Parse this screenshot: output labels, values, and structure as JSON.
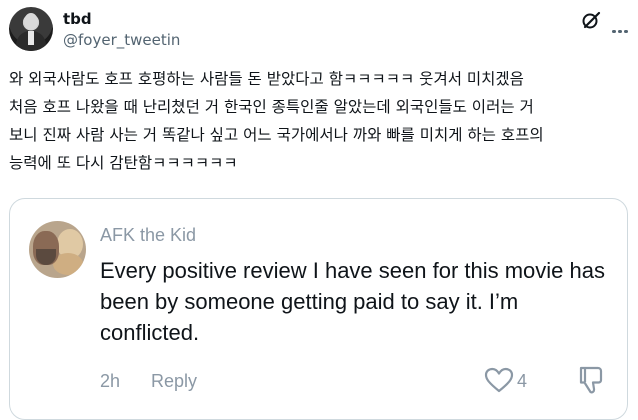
{
  "tweet": {
    "display_name": "tbd",
    "handle": "@foyer_tweetin",
    "icons": [
      "grok-icon",
      "more-icon"
    ],
    "lines": [
      "와 외국사람도 호프 호평하는 사람들 돈 받았다고 함ㅋㅋㅋㅋㅋ 웃겨서 미치겠음",
      "처음 호프 나왔을 때 난리쳤던 거 한국인 종특인줄 알았는데 외국인들도 이러는 거",
      "보니 진짜 사람 사는 거 똑같나 싶고 어느 국가에서나 까와 빠를 미치게 하는 호프의",
      "능력에 또 다시 감탄함ㅋㅋㅋㅋㅋㅋ"
    ]
  },
  "quoted_post": {
    "author": "AFK the Kid",
    "text": "Every positive review I have seen for this movie has been by someone getting paid to say it. I’m conflicted.",
    "time": "2h",
    "reply_label": "Reply",
    "like_count": "4",
    "icons": [
      "heart-icon",
      "dislike-icon"
    ]
  },
  "colors": {
    "text": "#0f1419",
    "secondary": "#536471",
    "muted": "#8b98a5",
    "border": "#cfd9de"
  }
}
